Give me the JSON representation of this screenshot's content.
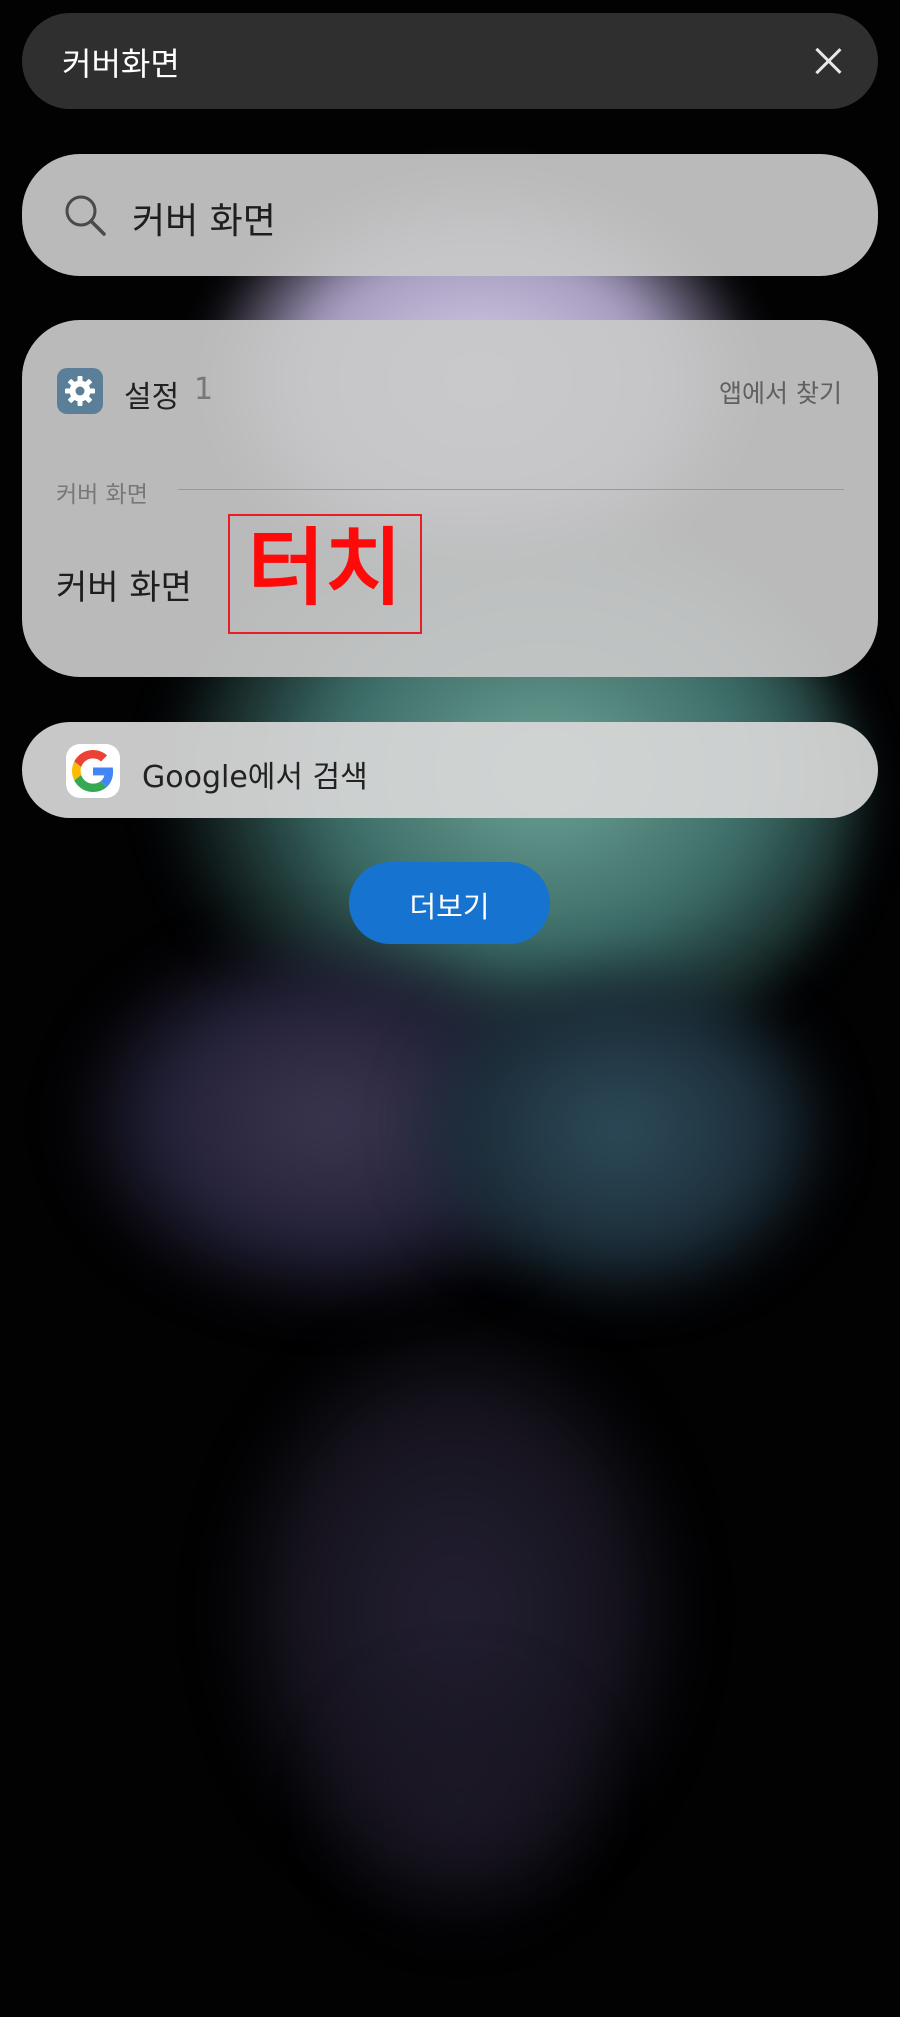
{
  "topbar": {
    "title": "커버화면"
  },
  "search": {
    "query": "커버 화면"
  },
  "result_card": {
    "app_name": "설정",
    "app_count": "1",
    "find_in_app": "앱에서 찾기",
    "section_label": "커버 화면",
    "item_label": "커버 화면",
    "annotation": "터치"
  },
  "google": {
    "label": "Google에서 검색"
  },
  "more_button": {
    "label": "더보기"
  },
  "colors": {
    "accent": "#1673d0",
    "annotation": "#ff0a0a",
    "settings_icon": "#5b7f98"
  },
  "icons": [
    "close-icon",
    "search-icon",
    "gear-icon",
    "google-icon"
  ]
}
